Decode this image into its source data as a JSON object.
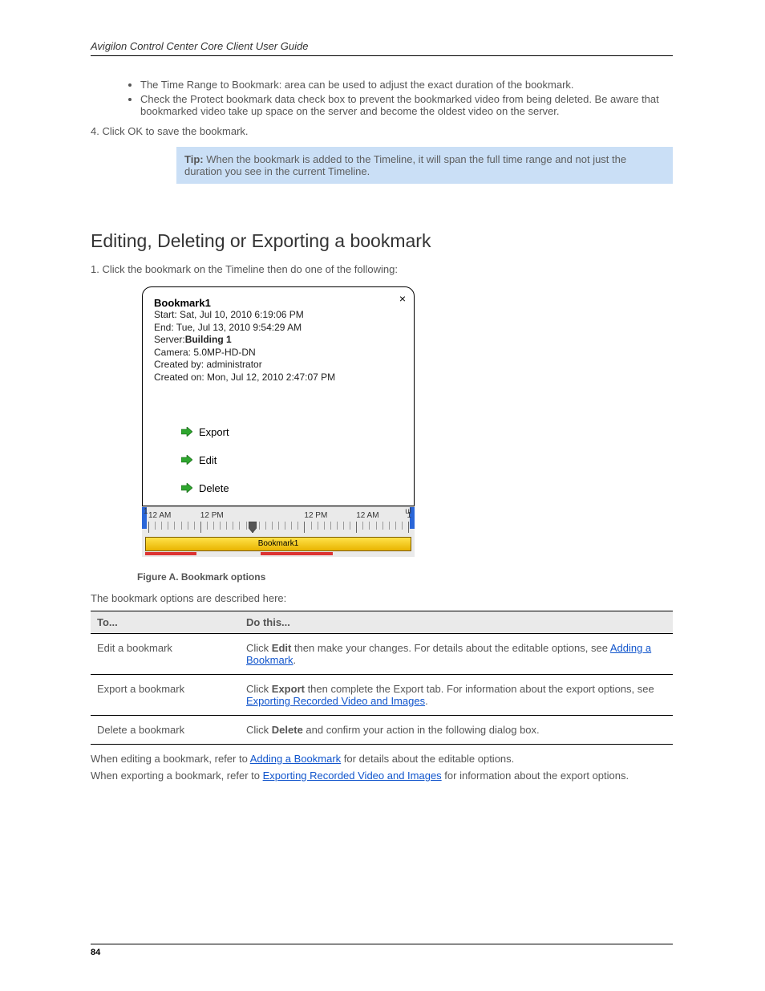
{
  "header": "Avigilon Control Center Core Client User Guide",
  "top_para": "4. Click OK to save the bookmark.",
  "top_list": [
    "The Time Range to Bookmark: area can be used to adjust the exact duration of the bookmark.",
    "Check the Protect bookmark data check box to prevent the bookmarked video from being deleted. Be aware that bookmarked video take up space on the server and become the oldest video on the server."
  ],
  "tip": {
    "label": "Tip:",
    "text": " When the bookmark is added to the Timeline, it will span the full time range and not just the duration you see in the current Timeline."
  },
  "section_title": "Editing, Deleting or Exporting a bookmark",
  "intro": "1. Click the bookmark on the Timeline then do one of the following:",
  "popup": {
    "name": "Bookmark1",
    "start": "Start: Sat, Jul 10, 2010 6:19:06 PM",
    "end": "End: Tue, Jul 13, 2010 9:54:29 AM",
    "server_label": "Server:",
    "server_value": "Building 1",
    "camera": "Camera: 5.0MP-HD-DN",
    "created_by": "Created by: administrator",
    "created_on": "Created on: Mon, Jul 12, 2010 2:47:07 PM",
    "actions": {
      "export": "Export",
      "edit": "Edit",
      "delete": "Delete"
    },
    "close": "×"
  },
  "timeline": {
    "edge_left": "1",
    "edge_right_top": "ul",
    "edge_right_bottom": "1",
    "labels": [
      "12 AM",
      "12 PM",
      "",
      "12 PM",
      "12 AM"
    ],
    "bookmark_label": "Bookmark1"
  },
  "figcap": "Figure A. Bookmark options",
  "after_fig": "The bookmark options are described here:",
  "table": {
    "head": [
      "To...",
      "Do this..."
    ],
    "rows": [
      {
        "l": "Edit a bookmark",
        "r_pre": "Click ",
        "r_b": "Edit",
        "r_post": " then make your changes. For details about the editable options, see ",
        "link": "Adding a Bookmark",
        "tail": "."
      },
      {
        "l": "Export a bookmark",
        "r_pre": "Click ",
        "r_b": "Export",
        "r_post": " then complete the Export tab. For information about the export options, see ",
        "link": "Exporting Recorded Video and Images",
        "tail": "."
      },
      {
        "l": "Delete a bookmark",
        "r_pre": "Click ",
        "r_b": "Delete",
        "r_post": " and confirm your action in the following dialog box.",
        "link": "",
        "tail": ""
      }
    ]
  },
  "footnotes": [
    {
      "pre": "When editing a bookmark, refer to ",
      "link": "Adding a Bookmark",
      "post": " for details about the editable options."
    },
    {
      "pre": "When exporting a bookmark, refer to ",
      "link": "Exporting Recorded Video and Images",
      "post": " for information about the export options."
    }
  ],
  "page_number": "84"
}
